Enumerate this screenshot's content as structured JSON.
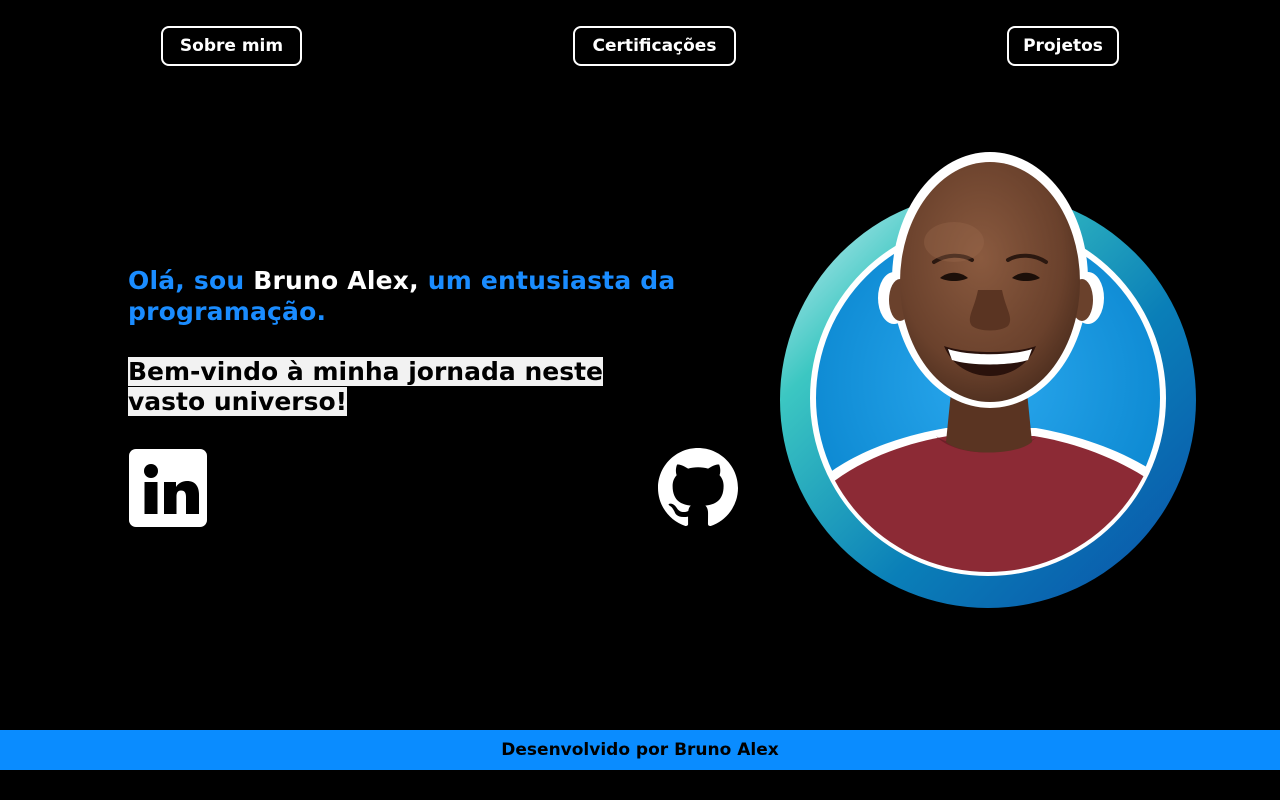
{
  "nav": {
    "about": "Sobre mim",
    "certifications": "Certificações",
    "projects": "Projetos"
  },
  "hero": {
    "greeting_prefix": "Olá, sou ",
    "name": "Bruno Alex,",
    "greeting_suffix": " um entusiasta da programação.",
    "welcome": "Bem-vindo à minha jornada neste vasto universo!"
  },
  "social": {
    "linkedin_icon": "linkedin-icon",
    "github_icon": "github-icon"
  },
  "profile": {
    "photo": "profile-photo"
  },
  "footer": {
    "text": "Desenvolvido por Bruno Alex"
  },
  "colors": {
    "accent": "#1a8cff",
    "footer_bg": "#0a8cff",
    "background": "#000000"
  }
}
